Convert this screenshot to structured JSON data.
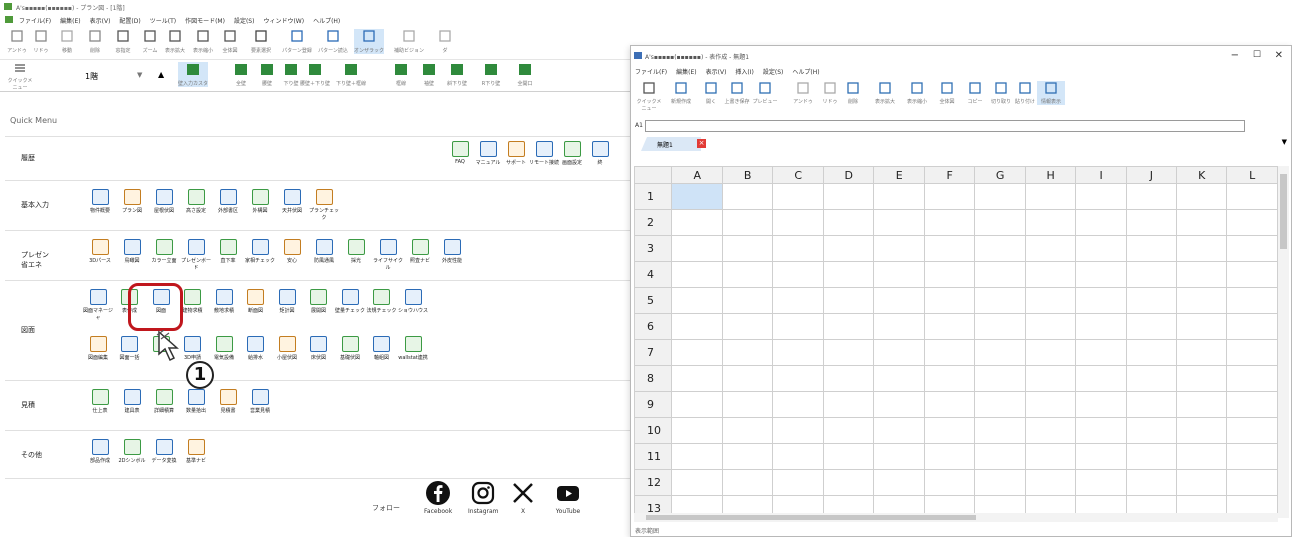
{
  "left_window": {
    "title": "A's▪▪▪▪▪(▪▪▪▪▪▪) - プラン図 - [1階]",
    "menu": [
      "ファイル(F)",
      "編集(E)",
      "表示(V)",
      "配置(D)",
      "ツール(T)",
      "作図モード(M)",
      "設定(S)",
      "ウィンドウ(W)",
      "ヘルプ(H)"
    ],
    "toolbar1": [
      "アンドゥ",
      "リドゥ",
      "移動",
      "削除",
      "窓指定",
      "ズーム",
      "表示拡大",
      "表示縮小",
      "全体図",
      "要素選択",
      "パターン登録",
      "パターン読込",
      "オンザラック",
      "補助ビジョン",
      "ダ"
    ],
    "toolbar2_left": "クイックメニュー",
    "floor": "1階",
    "toolbar2": [
      "壁入力カスタ",
      "全壁",
      "腰壁",
      "下り壁",
      "腰壁＋下り壁",
      "下り壁＋框線",
      "框線",
      "袖壁",
      "斜下り壁",
      "R下り壁",
      "全開口"
    ],
    "quick_menu_label": "Quick Menu",
    "rows": [
      {
        "label": "履歴",
        "items": [
          "FAQ",
          "マニュアル",
          "サポート",
          "リモート接続",
          "画面設定",
          "終"
        ]
      },
      {
        "label": "基本入力",
        "items": [
          "物件概要",
          "プラン図",
          "屋根伏図",
          "高さ設定",
          "外部書区",
          "外構図",
          "天井伏図",
          "プランチェック"
        ]
      },
      {
        "label": "プレゼン\n省エネ",
        "items": [
          "3Dパース",
          "鳥瞰図",
          "カラー立面",
          "プレゼンボード",
          "直下率",
          "家相チェック",
          "安心",
          "防風通風",
          "採光",
          "ライフサイクル",
          "照査ナビ",
          "外皮性能"
        ]
      },
      {
        "label": "図面",
        "items": [
          "図面マネージャ",
          "表作成",
          "図面",
          "建物求積",
          "敷地求積",
          "断面図",
          "矩計図",
          "展開図",
          "壁量チェック",
          "法規チェック",
          "ショウハウス",
          "図面編集",
          "図面一括",
          "",
          "3D申請",
          "電気設備",
          "給排水",
          "小屋伏図",
          "床伏図",
          "基礎伏図",
          "軸組図",
          "wallstat連携"
        ]
      },
      {
        "label": "見積",
        "items": [
          "仕上表",
          "建具表",
          "詳細積算",
          "数量拾出",
          "見積書",
          "営業見積"
        ]
      },
      {
        "label": "その他",
        "items": [
          "部品作成",
          "2Dシンボル",
          "データ変換",
          "基準ナビ"
        ]
      }
    ],
    "callout_number": "1",
    "follow_label": "フォロー",
    "social": [
      "Facebook",
      "Instagram",
      "X",
      "YouTube"
    ]
  },
  "right_window": {
    "title": "A's▪▪▪▪▪(▪▪▪▪▪▪) - 表作成 - 無題1",
    "menu": [
      "ファイル(F)",
      "編集(E)",
      "表示(V)",
      "挿入(I)",
      "設定(S)",
      "ヘルプ(H)"
    ],
    "toolbar": [
      "クイックメニュー",
      "新規作成",
      "開く",
      "上書き保存",
      "プレビュー",
      "アンドゥ",
      "リドゥ",
      "削除",
      "表示拡大",
      "表示縮小",
      "全体図",
      "コピー",
      "切り取り",
      "貼り付け",
      "情報表示"
    ],
    "cell_ref": "A1",
    "sheet_tab": "無題1",
    "columns": [
      "A",
      "B",
      "C",
      "D",
      "E",
      "F",
      "G",
      "H",
      "I",
      "J",
      "K",
      "L"
    ],
    "rows": [
      "1",
      "2",
      "3",
      "4",
      "5",
      "6",
      "7",
      "8",
      "9",
      "10",
      "11",
      "12",
      "13"
    ],
    "status": "表示範囲"
  },
  "colors": {
    "highlight": "#c0171d",
    "accent_green": "#3c9a44",
    "accent_teal": "#2e7b8c",
    "accent_blue": "#2b6bb6",
    "selection": "#cfe3f7"
  }
}
